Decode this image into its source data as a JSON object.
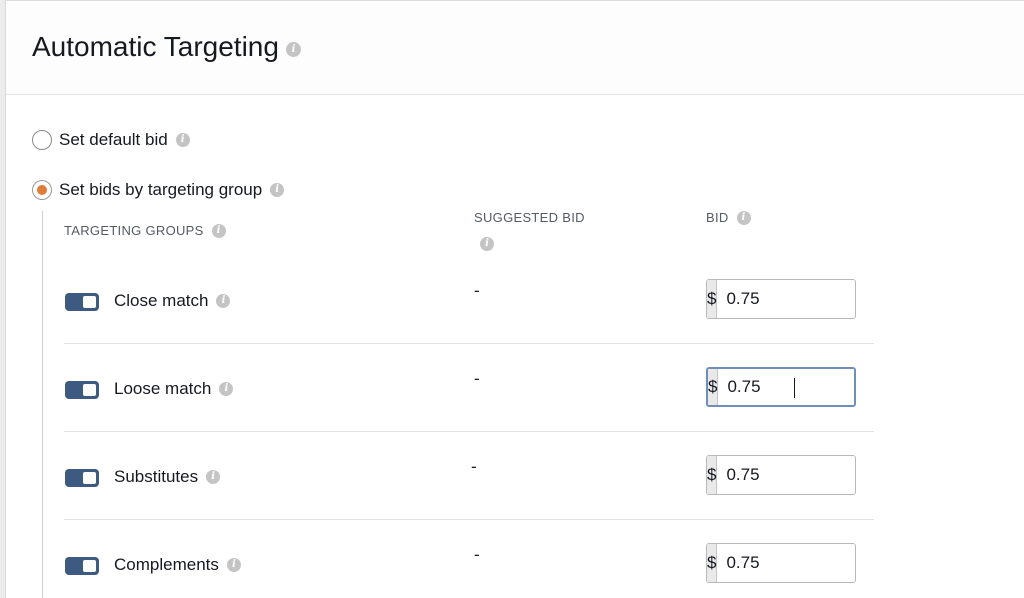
{
  "header": {
    "title": "Automatic Targeting"
  },
  "bid_options": [
    {
      "label": "Set default bid",
      "selected": false
    },
    {
      "label": "Set bids by targeting group",
      "selected": true
    }
  ],
  "columns": {
    "targeting_groups": "TARGETING GROUPS",
    "suggested_bid": "SUGGESTED BID",
    "bid": "BID"
  },
  "currency_symbol": "$",
  "rows": [
    {
      "label": "Close match",
      "enabled": true,
      "suggested_bid": "-",
      "bid": "0.75"
    },
    {
      "label": "Loose match",
      "enabled": true,
      "suggested_bid": "-",
      "bid": "0.75"
    },
    {
      "label": "Substitutes",
      "enabled": true,
      "suggested_bid": "-",
      "bid": "0.75"
    },
    {
      "label": "Complements",
      "enabled": true,
      "suggested_bid": "-",
      "bid": "0.75"
    }
  ],
  "colors": {
    "radio_selected": "#e07b39",
    "toggle_on": "#3d5a80",
    "focus_border": "#6f8fb8"
  },
  "icons": {
    "info": "info-icon"
  }
}
